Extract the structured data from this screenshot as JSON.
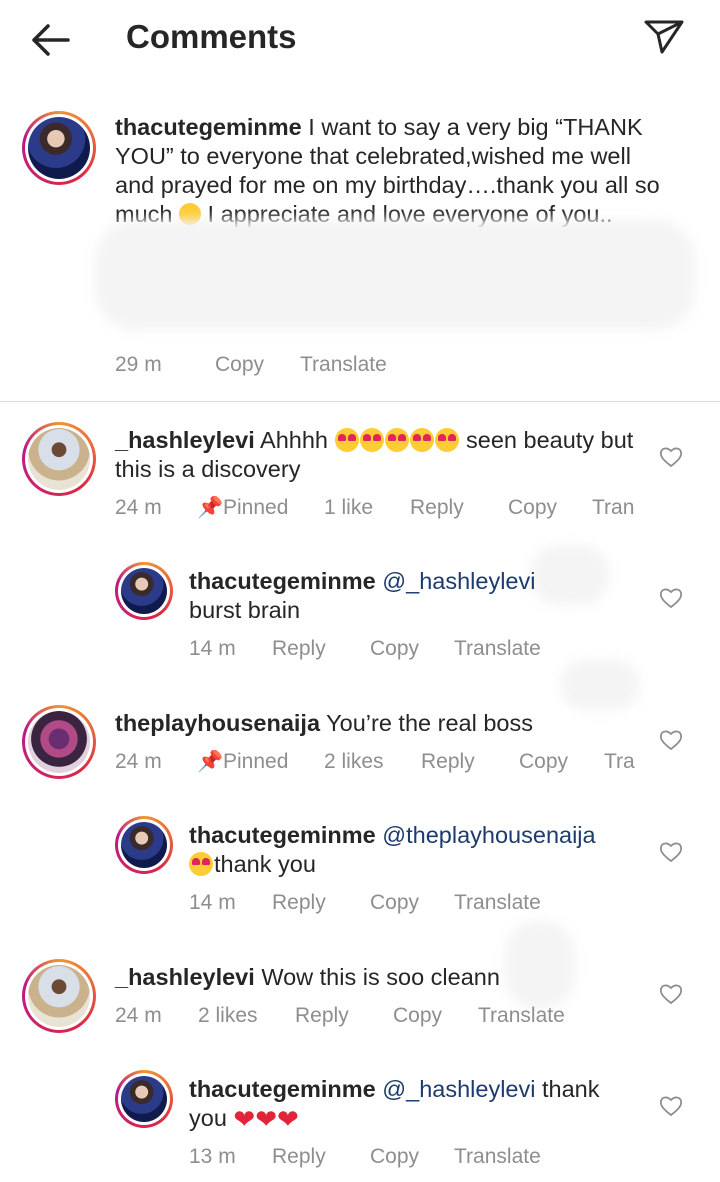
{
  "header": {
    "title": "Comments",
    "back_icon": "arrow-left-icon",
    "send_icon": "paper-plane-icon"
  },
  "caption": {
    "username": "thacutegeminme",
    "text_1": " I want to say a very big “THANK YOU” to everyone that celebrated,wished me well and prayed for me on my birthday….thank you all so much ",
    "text_2": " I appreciate and love everyone of you..",
    "meta": {
      "time": "29 m",
      "copy": "Copy",
      "translate": "Translate"
    }
  },
  "comments": [
    {
      "username": "_hashleylevi",
      "text_1": " Ahhhh ",
      "text_2": " seen beauty but this is a discovery",
      "meta": {
        "time": "24 m",
        "pinned": "Pinned",
        "likes": "1 like",
        "reply": "Reply",
        "copy": "Copy",
        "translate": "Tran"
      },
      "reply": {
        "username": "thacutegeminme",
        "mention": "@_hashleylevi",
        "text": "burst brain",
        "meta": {
          "time": "14 m",
          "reply": "Reply",
          "copy": "Copy",
          "translate": "Translate"
        }
      }
    },
    {
      "username": "theplayhousenaija",
      "text": " You’re the real boss",
      "meta": {
        "time": "24 m",
        "pinned": "Pinned",
        "likes": "2 likes",
        "reply": "Reply",
        "copy": "Copy",
        "translate": "Tra"
      },
      "reply": {
        "username": "thacutegeminme",
        "mention": "@theplayhousenaija",
        "text": "thank you",
        "meta": {
          "time": "14 m",
          "reply": "Reply",
          "copy": "Copy",
          "translate": "Translate"
        }
      }
    },
    {
      "username": "_hashleylevi",
      "text": " Wow this is soo cleann",
      "meta": {
        "time": "24 m",
        "likes": "2 likes",
        "reply": "Reply",
        "copy": "Copy",
        "translate": "Translate"
      },
      "reply": {
        "username": "thacutegeminme",
        "mention": "@_hashleylevi",
        "text": " thank you ",
        "meta": {
          "time": "13 m",
          "reply": "Reply",
          "copy": "Copy",
          "translate": "Translate"
        }
      }
    }
  ],
  "colors": {
    "text": "#262626",
    "meta": "#8e8e8e",
    "mention": "#1d3b6e",
    "heart_red": "#e0243a"
  }
}
